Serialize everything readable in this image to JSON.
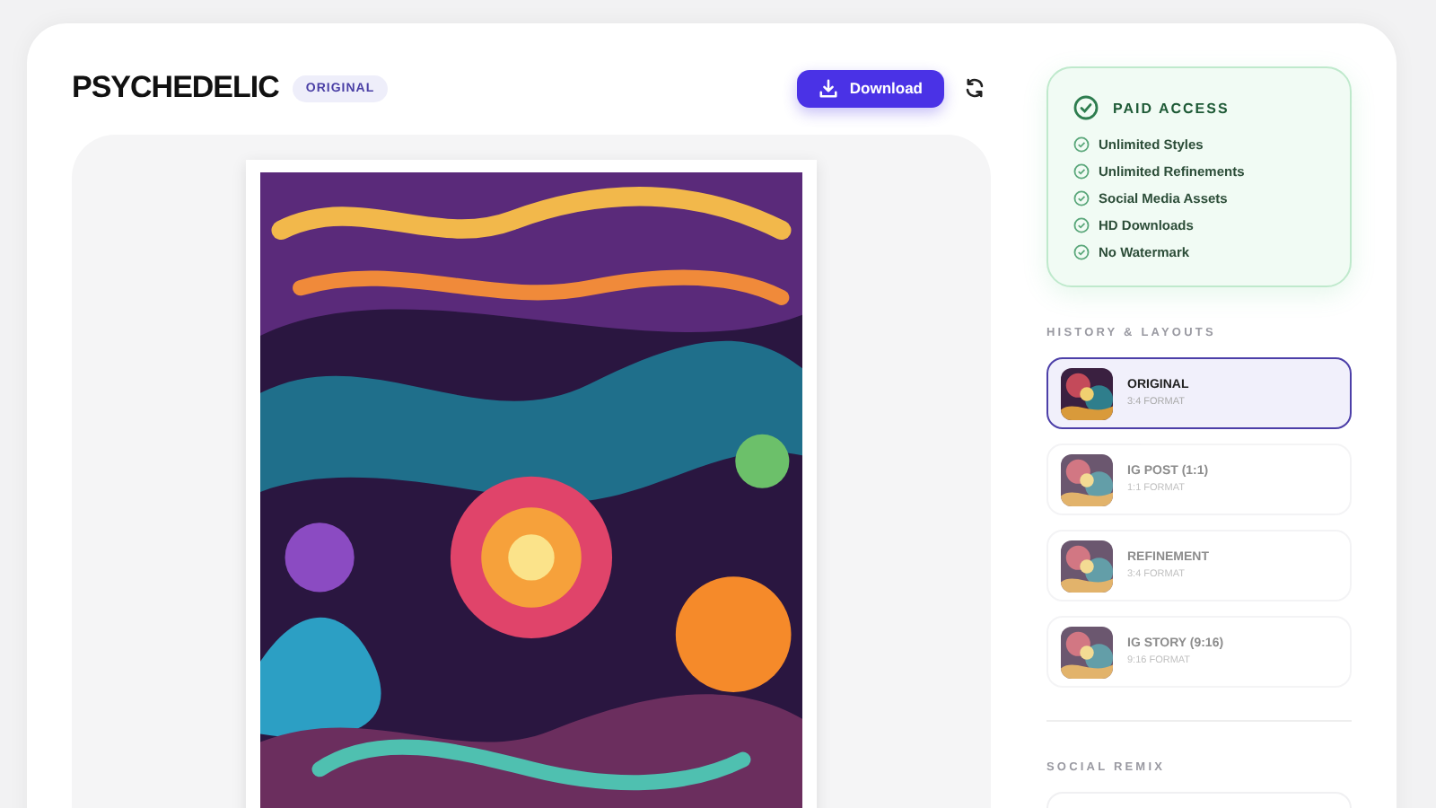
{
  "header": {
    "title": "PSYCHEDELIC",
    "badge": "ORIGINAL",
    "download_button": "Download"
  },
  "paid_access": {
    "title": "PAID ACCESS",
    "features": [
      "Unlimited Styles",
      "Unlimited Refinements",
      "Social Media Assets",
      "HD Downloads",
      "No Watermark"
    ]
  },
  "history": {
    "heading": "HISTORY & LAYOUTS",
    "items": [
      {
        "title": "ORIGINAL",
        "format": "3:4 FORMAT",
        "selected": true
      },
      {
        "title": "IG POST (1:1)",
        "format": "1:1 FORMAT",
        "selected": false
      },
      {
        "title": "REFINEMENT",
        "format": "3:4 FORMAT",
        "selected": false
      },
      {
        "title": "IG STORY (9:16)",
        "format": "9:16 FORMAT",
        "selected": false
      }
    ]
  },
  "social_remix": {
    "heading": "SOCIAL REMIX"
  }
}
